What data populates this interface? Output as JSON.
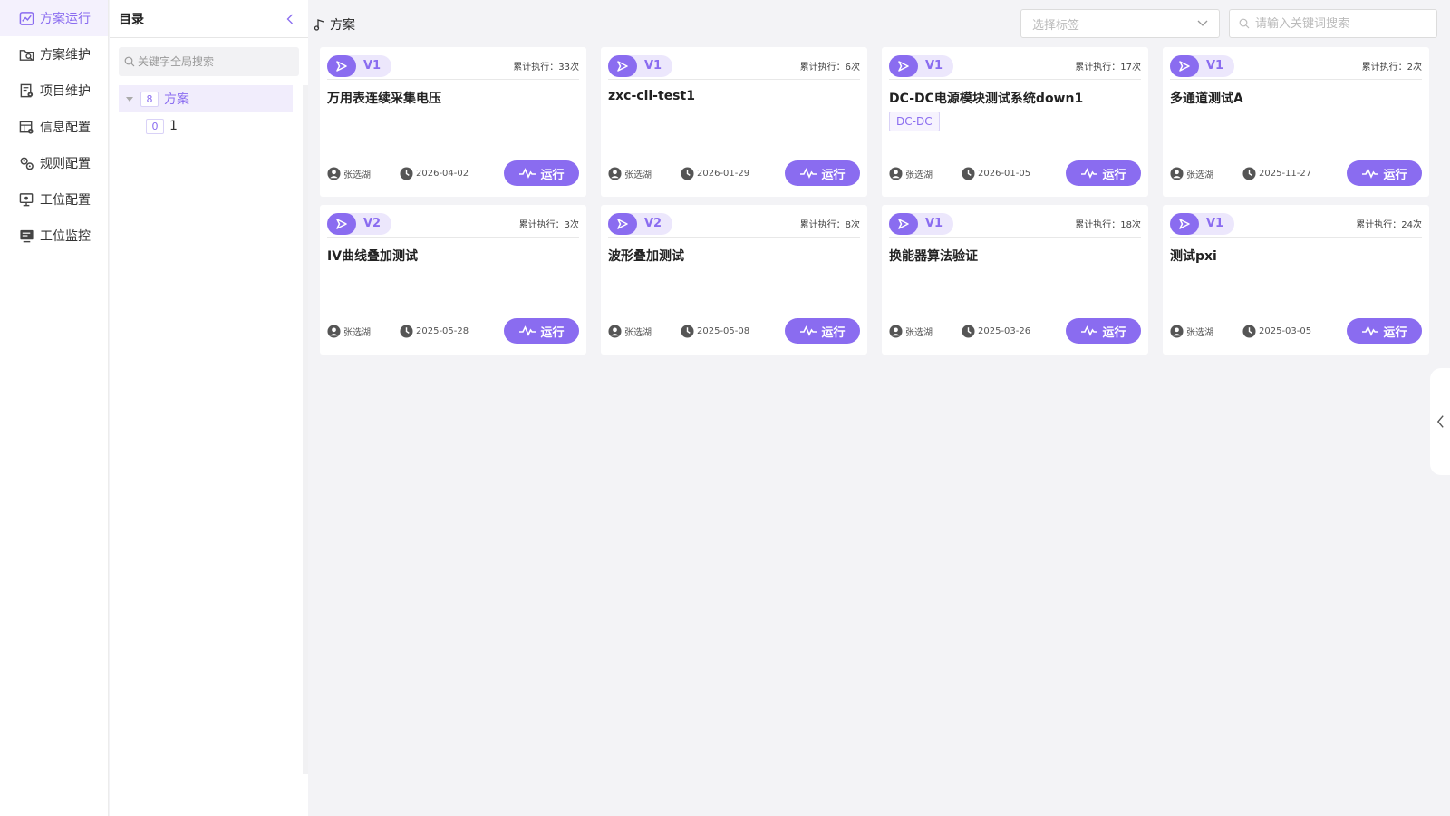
{
  "nav": {
    "items": [
      {
        "label": "方案运行",
        "icon": "chart-line-icon",
        "active": true
      },
      {
        "label": "方案维护",
        "icon": "folder-search-icon",
        "active": false
      },
      {
        "label": "项目维护",
        "icon": "document-gear-icon",
        "active": false
      },
      {
        "label": "信息配置",
        "icon": "table-settings-icon",
        "active": false
      },
      {
        "label": "规则配置",
        "icon": "rules-gears-icon",
        "active": false
      },
      {
        "label": "工位配置",
        "icon": "monitor-gear-icon",
        "active": false
      },
      {
        "label": "工位监控",
        "icon": "monitor-list-icon",
        "active": false
      }
    ]
  },
  "directory": {
    "title": "目录",
    "search_placeholder": "关键字全局搜索",
    "tree": {
      "root": {
        "count": "8",
        "label": "方案"
      },
      "child": {
        "count": "0",
        "label": "1"
      }
    }
  },
  "header": {
    "breadcrumb": "方案",
    "tag_select_placeholder": "选择标签",
    "search_placeholder": "请输入关键词搜索"
  },
  "run_label": "运行",
  "cards": [
    {
      "version": "V1",
      "executions": "累计执行：33次",
      "name": "万用表连续采集电压",
      "tag": "",
      "user": "张选湖",
      "date": "2026-04-02"
    },
    {
      "version": "V1",
      "executions": "累计执行：6次",
      "name": "zxc-cli-test1",
      "tag": "",
      "user": "张选湖",
      "date": "2026-01-29"
    },
    {
      "version": "V1",
      "executions": "累计执行：17次",
      "name": "DC-DC电源模块测试系统down1",
      "tag": "DC-DC",
      "user": "张选湖",
      "date": "2026-01-05"
    },
    {
      "version": "V1",
      "executions": "累计执行：2次",
      "name": "多通道测试A",
      "tag": "",
      "user": "张选湖",
      "date": "2025-11-27"
    },
    {
      "version": "V2",
      "executions": "累计执行：3次",
      "name": "IV曲线叠加测试",
      "tag": "",
      "user": "张选湖",
      "date": "2025-05-28"
    },
    {
      "version": "V2",
      "executions": "累计执行：8次",
      "name": "波形叠加测试",
      "tag": "",
      "user": "张选湖",
      "date": "2025-05-08"
    },
    {
      "version": "V1",
      "executions": "累计执行：18次",
      "name": "换能器算法验证",
      "tag": "",
      "user": "张选湖",
      "date": "2025-03-26"
    },
    {
      "version": "V1",
      "executions": "累计执行：24次",
      "name": "测试pxi",
      "tag": "",
      "user": "张选湖",
      "date": "2025-03-05"
    }
  ],
  "colors": {
    "accent": "#8a6cf0",
    "accent_light": "#ece7fc",
    "background": "#f3f3f6"
  }
}
